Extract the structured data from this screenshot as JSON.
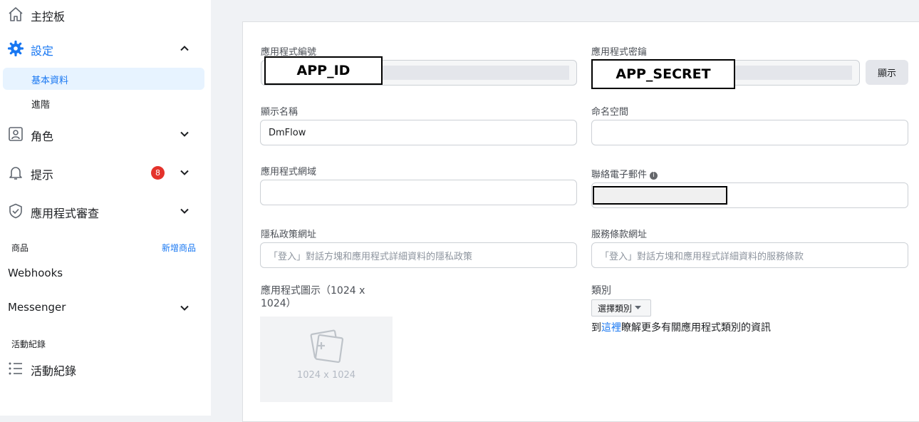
{
  "sidebar": {
    "items": {
      "dashboard": "主控板",
      "settings": "設定",
      "basic": "基本資料",
      "advanced": "進階",
      "roles": "角色",
      "alerts": "提示",
      "alerts_badge": "8",
      "app_review": "應用程式審查",
      "products_section": "商品",
      "add_product": "新增商品",
      "webhooks": "Webhooks",
      "messenger": "Messenger",
      "activity_section": "活動紀錄",
      "activity_log": "活動紀錄"
    },
    "accent_color": "#1877f2"
  },
  "form": {
    "app_id": {
      "label": "應用程式編號",
      "redacted": "APP_ID"
    },
    "app_secret": {
      "label": "應用程式密鑰",
      "redacted": "APP_SECRET",
      "show_button": "顯示"
    },
    "display_name": {
      "label": "顯示名稱",
      "value": "DmFlow"
    },
    "namespace": {
      "label": "命名空間",
      "value": ""
    },
    "app_domains": {
      "label": "應用程式網域",
      "value": ""
    },
    "contact_email": {
      "label": "聯絡電子郵件"
    },
    "privacy_url": {
      "label": "隱私政策網址",
      "placeholder": "「登入」對話方塊和應用程式詳細資料的隱私政策"
    },
    "terms_url": {
      "label": "服務條款網址",
      "placeholder": "「登入」對話方塊和應用程式詳細資料的服務條款"
    },
    "app_icon": {
      "label_line1": "應用程式圖示（1024 x",
      "label_line2": "1024）",
      "size_text": "1024 x 1024"
    },
    "category": {
      "label": "類別",
      "select": "選擇類別",
      "help_prefix": "到",
      "help_link": "這裡",
      "help_suffix": "瞭解更多有關應用程式類別的資訊"
    }
  }
}
